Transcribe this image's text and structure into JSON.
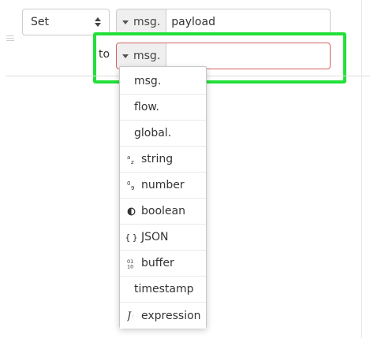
{
  "rule": {
    "action": {
      "selected": "Set"
    },
    "property": {
      "type_label": "msg.",
      "value": "payload"
    },
    "to": {
      "label": "to",
      "type_label": "msg.",
      "value": ""
    }
  },
  "type_menu": {
    "items": [
      {
        "label": "msg.",
        "icon": ""
      },
      {
        "label": "flow.",
        "icon": ""
      },
      {
        "label": "global.",
        "icon": ""
      },
      {
        "label": "string",
        "icon": "string-icon"
      },
      {
        "label": "number",
        "icon": "number-icon"
      },
      {
        "label": "boolean",
        "icon": "boolean-icon"
      },
      {
        "label": "JSON",
        "icon": "json-icon"
      },
      {
        "label": "buffer",
        "icon": "buffer-icon"
      },
      {
        "label": "timestamp",
        "icon": ""
      },
      {
        "label": "expression",
        "icon": "expression-icon"
      }
    ]
  },
  "colors": {
    "highlight": "#22e03a",
    "error_border": "#d6615f"
  }
}
